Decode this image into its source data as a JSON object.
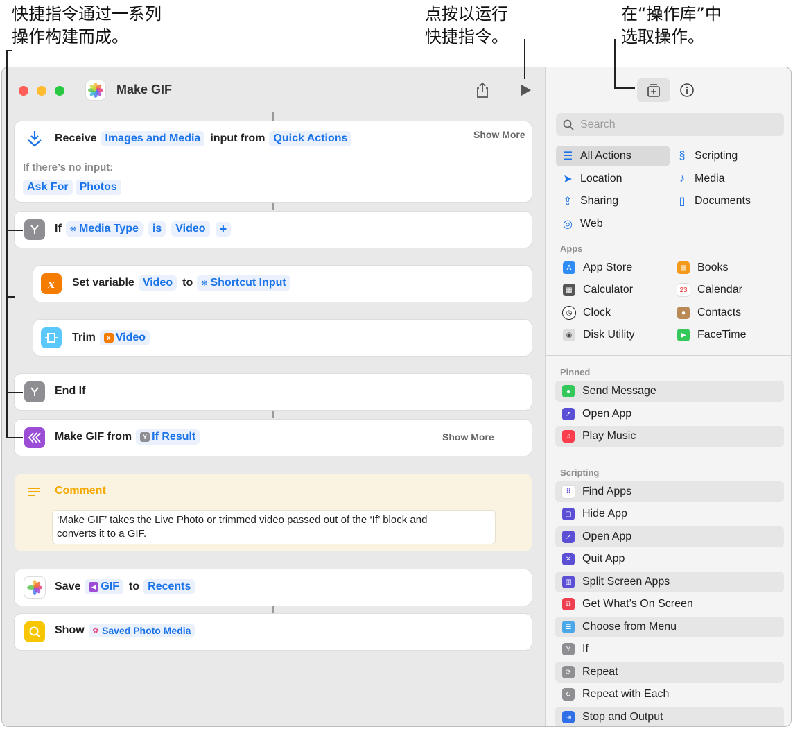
{
  "callouts": {
    "left_line1": "快捷指令通过一系列",
    "left_line2": "操作构建而成。",
    "mid_line1": "点按以运行",
    "mid_line2": "快捷指令。",
    "right_line1": "在“操作库”中",
    "right_line2": "选取操作。"
  },
  "window": {
    "title": "Make GIF"
  },
  "editor": {
    "receive": {
      "verb": "Receive",
      "type_token": "Images and Media",
      "mid": "input from",
      "source_token": "Quick Actions",
      "show_more": "Show More",
      "no_input_label": "If there’s no input:",
      "ask_for": "Ask For",
      "photos": "Photos"
    },
    "if_block": {
      "verb": "If",
      "var_token": "Media Type",
      "op_token": "is",
      "value_token": "Video",
      "add": "+"
    },
    "set_variable": {
      "verb": "Set variable",
      "name_token": "Video",
      "mid": "to",
      "value_token": "Shortcut Input",
      "icon_glyph": "x"
    },
    "trim": {
      "verb": "Trim",
      "token": "Video"
    },
    "end_if": {
      "verb": "End If"
    },
    "make_gif": {
      "verb": "Make GIF from",
      "token": "If Result",
      "show_more": "Show More"
    },
    "comment": {
      "title": "Comment",
      "line1": "‘Make GIF’ takes the Live Photo or trimmed video passed out of the ‘If’ block and",
      "line2": "converts it to a GIF."
    },
    "save": {
      "verb": "Save",
      "token": "GIF",
      "mid": "to",
      "dest_token": "Recents"
    },
    "show": {
      "verb": "Show",
      "token": "Saved Photo Media"
    }
  },
  "sidebar": {
    "search_placeholder": "Search",
    "categories": {
      "all_actions": "All Actions",
      "scripting": "Scripting",
      "location": "Location",
      "media": "Media",
      "sharing": "Sharing",
      "documents": "Documents",
      "web": "Web"
    },
    "apps_label": "Apps",
    "apps": {
      "app_store": "App Store",
      "books": "Books",
      "calculator": "Calculator",
      "calendar": "Calendar",
      "calendar_day": "23",
      "clock": "Clock",
      "contacts": "Contacts",
      "disk_utility": "Disk Utility",
      "facetime": "FaceTime"
    },
    "pinned_label": "Pinned",
    "pinned": {
      "send_message": "Send Message",
      "open_app": "Open App",
      "play_music": "Play Music"
    },
    "scripting_label": "Scripting",
    "scripting": {
      "find_apps": "Find Apps",
      "hide_app": "Hide App",
      "open_app": "Open App",
      "quit_app": "Quit App",
      "split_screen": "Split Screen Apps",
      "get_on_screen": "Get What’s On Screen",
      "choose_menu": "Choose from Menu",
      "if": "If",
      "repeat": "Repeat",
      "repeat_each": "Repeat with Each",
      "stop_output": "Stop and Output"
    }
  },
  "colors": {
    "accent": "#1a73e8",
    "close": "#ff5f57",
    "minimize": "#febc2e",
    "zoom": "#28c840",
    "comment_bg": "#fbf3e1",
    "comment_title": "#f5a800"
  }
}
